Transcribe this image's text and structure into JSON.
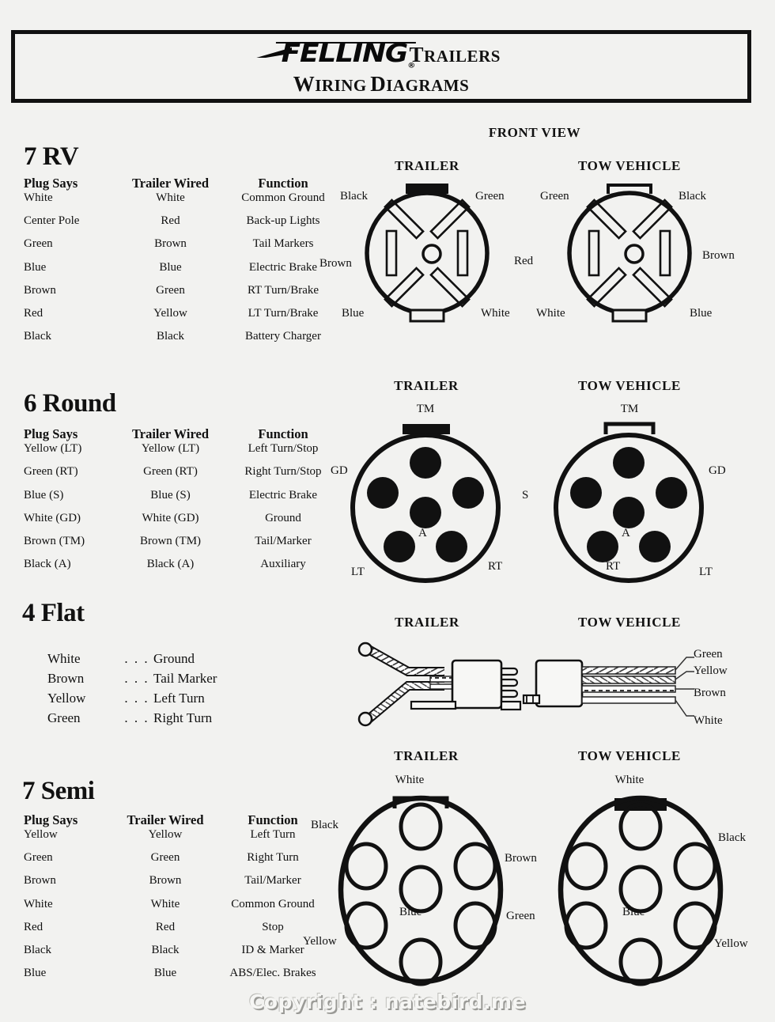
{
  "header": {
    "brand": "FELLING",
    "brand_reg": "®",
    "trailers": "TRAILERS",
    "title": "WIRING DIAGRAMS"
  },
  "front_view_label": "FRONT VIEW",
  "diagram_titles": {
    "trailer": "TRAILER",
    "tow_vehicle": "TOW VEHICLE"
  },
  "columns": {
    "plug_says": "Plug Says",
    "trailer_wired": "Trailer Wired",
    "function": "Function"
  },
  "sections": {
    "rv7": {
      "title": "7 RV",
      "rows": [
        {
          "plug": "White",
          "wired": "White",
          "function": "Common Ground"
        },
        {
          "plug": "Center Pole",
          "wired": "Red",
          "function": "Back-up Lights"
        },
        {
          "plug": "Green",
          "wired": "Brown",
          "function": "Tail Markers"
        },
        {
          "plug": "Blue",
          "wired": "Blue",
          "function": "Electric Brake"
        },
        {
          "plug": "Brown",
          "wired": "Green",
          "function": "RT Turn/Brake"
        },
        {
          "plug": "Red",
          "wired": "Yellow",
          "function": "LT Turn/Brake"
        },
        {
          "plug": "Black",
          "wired": "Black",
          "function": "Battery Charger"
        }
      ],
      "trailer_labels": {
        "top_left": "Black",
        "top_right": "Green",
        "left": "Brown",
        "bottom_left": "Blue",
        "bottom_right": "White"
      },
      "center_label": "Red",
      "tow_labels": {
        "top_left": "Green",
        "top_right": "Black",
        "right": "Brown",
        "bottom_left": "White",
        "bottom_right": "Blue"
      }
    },
    "round6": {
      "title": "6 Round",
      "rows": [
        {
          "plug": "Yellow (LT)",
          "wired": "Yellow (LT)",
          "function": "Left Turn/Stop"
        },
        {
          "plug": "Green (RT)",
          "wired": "Green (RT)",
          "function": "Right Turn/Stop"
        },
        {
          "plug": "Blue (S)",
          "wired": "Blue (S)",
          "function": "Electric Brake"
        },
        {
          "plug": "White (GD)",
          "wired": "White (GD)",
          "function": "Ground"
        },
        {
          "plug": "Brown (TM)",
          "wired": "Brown (TM)",
          "function": "Tail/Marker"
        },
        {
          "plug": "Black (A)",
          "wired": "Black (A)",
          "function": "Auxiliary"
        }
      ],
      "trailer_labels": {
        "top": "TM",
        "left": "GD",
        "center": "A",
        "bottom_left": "LT",
        "bottom_right": "RT"
      },
      "center_label": "S",
      "tow_labels": {
        "top": "TM",
        "right": "GD",
        "center": "A",
        "bottom_left": "RT",
        "bottom_right": "LT"
      }
    },
    "flat4": {
      "title": "4 Flat",
      "rows": [
        {
          "color": "White",
          "dots": ". . .",
          "function": "Ground"
        },
        {
          "color": "Brown",
          "dots": ". . .",
          "function": "Tail Marker"
        },
        {
          "color": "Yellow",
          "dots": ". . .",
          "function": "Left Turn"
        },
        {
          "color": "Green",
          "dots": ". . .",
          "function": "Right Turn"
        }
      ],
      "wire_labels": [
        "Green",
        "Yellow",
        "Brown",
        "White"
      ]
    },
    "semi7": {
      "title": "7 Semi",
      "rows": [
        {
          "plug": "Yellow",
          "wired": "Yellow",
          "function": "Left Turn"
        },
        {
          "plug": "Green",
          "wired": "Green",
          "function": "Right Turn"
        },
        {
          "plug": "Brown",
          "wired": "Brown",
          "function": "Tail/Marker"
        },
        {
          "plug": "White",
          "wired": "White",
          "function": "Common Ground"
        },
        {
          "plug": "Red",
          "wired": "Red",
          "function": "Stop"
        },
        {
          "plug": "Black",
          "wired": "Black",
          "function": "ID  & Marker"
        },
        {
          "plug": "Blue",
          "wired": "Blue",
          "function": "ABS/Elec. Brakes"
        }
      ],
      "trailer_labels": {
        "top": "White",
        "top_left": "Black",
        "bottom_left": "Yellow",
        "center": "Blue"
      },
      "center_labels": {
        "upper": "Brown",
        "lower": "Green"
      },
      "tow_labels": {
        "top": "White",
        "top_right": "Black",
        "bottom_right": "Yellow",
        "center": "Blue"
      }
    }
  },
  "watermark": "Copyright : natebird.me"
}
